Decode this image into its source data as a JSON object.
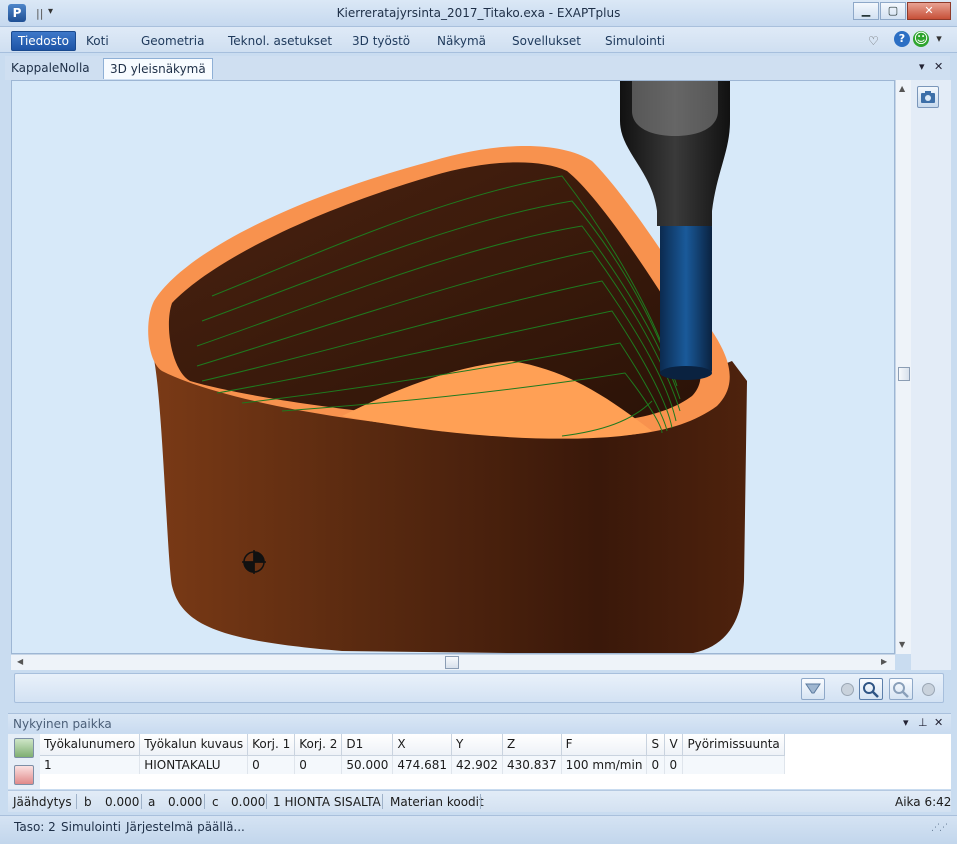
{
  "window": {
    "title": "Kierreratajyrsinta_2017_Titako.exa - EXAPTplus",
    "app_icon_letter": "P",
    "qat_separator": "||",
    "qat_dropdown": "▾",
    "minimize": "▁",
    "maximize": "▢",
    "close": "✕"
  },
  "ribbon": {
    "tabs": [
      "Tiedosto",
      "Koti",
      "Geometria",
      "Teknol. asetukset",
      "3D työstö",
      "Näkymä",
      "Sovellukset",
      "Simulointi"
    ],
    "collapse_glyph": "♡",
    "help_glyph": "?",
    "smiley_glyph": "☺",
    "options_glyph": "▾"
  },
  "doc_tabs": {
    "tabs": [
      "KappaleNolla",
      "3D yleisnäkymä"
    ],
    "active_index": 1,
    "menu_glyph": "▾",
    "close_glyph": "✕"
  },
  "viewport": {
    "colors": {
      "background": "#d7e9f9",
      "rim": "#f8924e",
      "inner_wall": "#3b1a0c",
      "outer_wall": "#5a2a10",
      "floor": "#ffa055",
      "toolpath": "#1f7a1f",
      "spindle": "#222222",
      "tool_shank": "#0f3b6b"
    },
    "origin_marker": "crosshair-circle"
  },
  "scrollbars": {
    "up": "▲",
    "down": "▼",
    "left": "◀",
    "right": "▶"
  },
  "position_panel": {
    "title": "Nykyinen paikka",
    "menu_glyph": "▾",
    "pin_glyph": "⊥",
    "close_glyph": "✕",
    "columns": [
      "Työkalunumero",
      "Työkalun kuvaus",
      "Korj. 1",
      "Korj. 2",
      "D1",
      "X",
      "Y",
      "Z",
      "F",
      "S",
      "V",
      "Pyörimissuunta"
    ],
    "rows": [
      [
        "1",
        "HIONTAKALU",
        "0",
        "0",
        "50.000",
        "474.681",
        "42.902",
        "430.837",
        "100 mm/min",
        "0",
        "0",
        ""
      ]
    ]
  },
  "status_bar_1": {
    "cooling": "Jäähdytys",
    "b_label": "b",
    "b_value": "0.000",
    "a_label": "a",
    "a_value": "0.000",
    "c_label": "c",
    "c_value": "0.000",
    "operation": "1 HIONTA SISALTA",
    "material_codes": "Materian koodit",
    "time": "Aika 6:42"
  },
  "status_bar_2": {
    "level": "Taso: 2",
    "mode": "Simulointi",
    "system": "Järjestelmä päällä..."
  }
}
